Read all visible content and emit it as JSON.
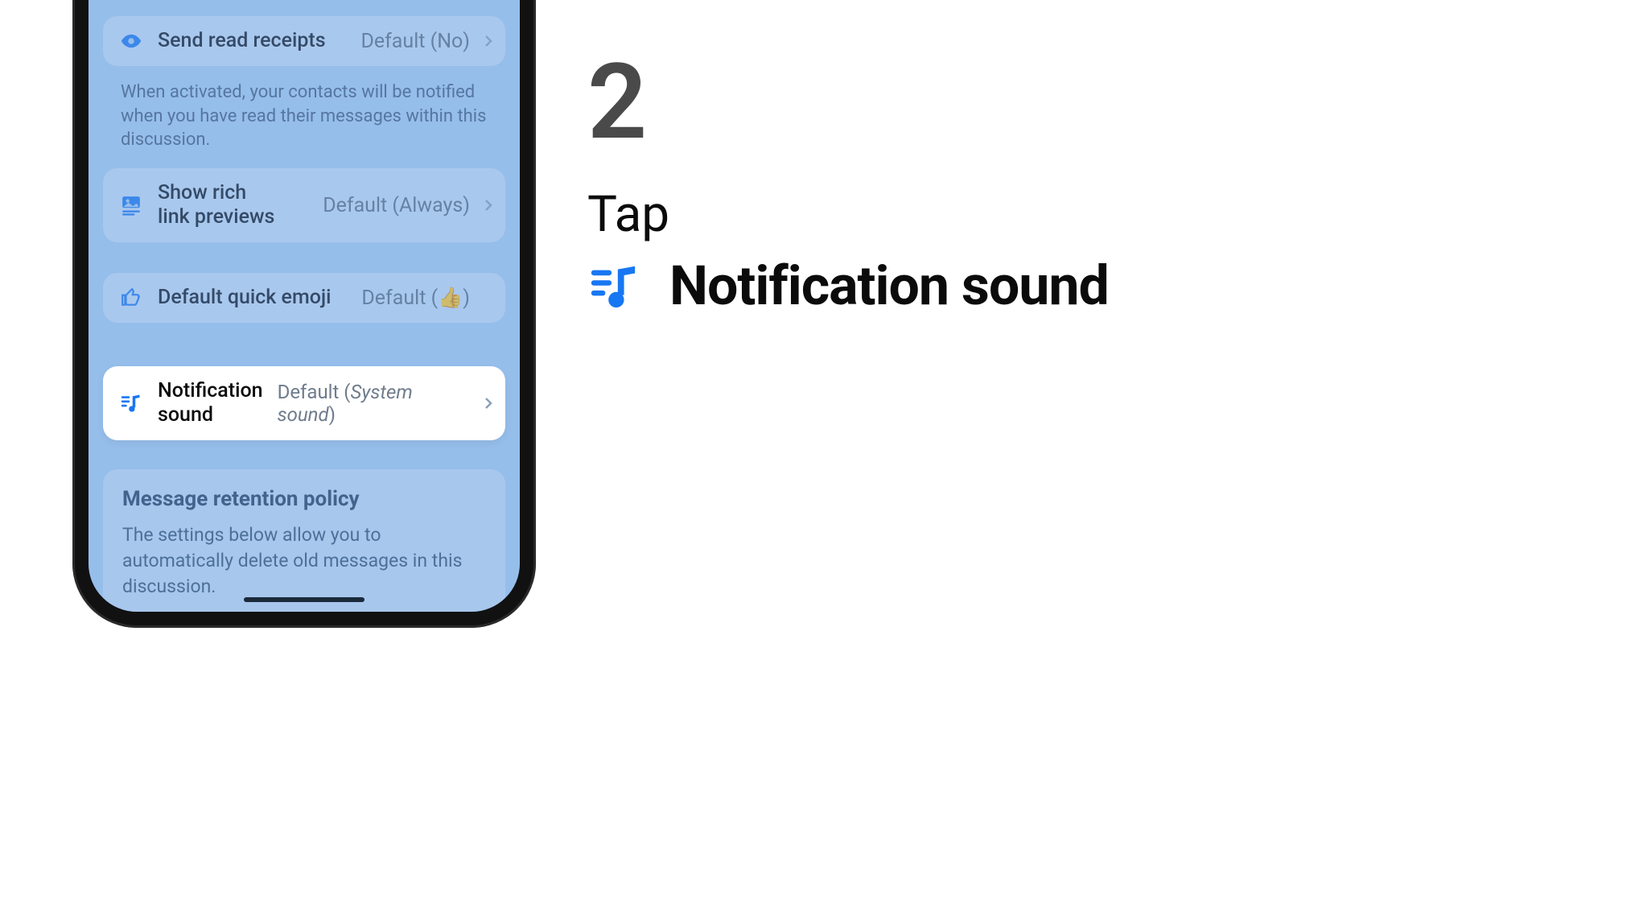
{
  "instruction": {
    "step_number": "2",
    "action": "Tap",
    "target_label": "Notification sound"
  },
  "phone": {
    "rows": {
      "read_receipts": {
        "title": "Send read receipts",
        "value": "Default (No)",
        "desc": "When activated, your contacts will be notified when you have read their messages within this discussion."
      },
      "rich_link": {
        "title_line1": "Show rich",
        "title_line2": "link previews",
        "value": "Default (Always)"
      },
      "quick_emoji": {
        "title": "Default quick emoji",
        "value_prefix": "Default (",
        "value_emoji": "👍",
        "value_suffix": ")"
      },
      "notification_sound": {
        "title_line1": "Notification",
        "title_line2": "sound",
        "value_prefix": "Default (",
        "value_italic": "System sound",
        "value_suffix": ")"
      }
    },
    "retention": {
      "heading": "Message retention policy",
      "body": "The settings below allow you to automatically delete old messages in this discussion."
    }
  },
  "colors": {
    "accent": "#1877F2"
  }
}
